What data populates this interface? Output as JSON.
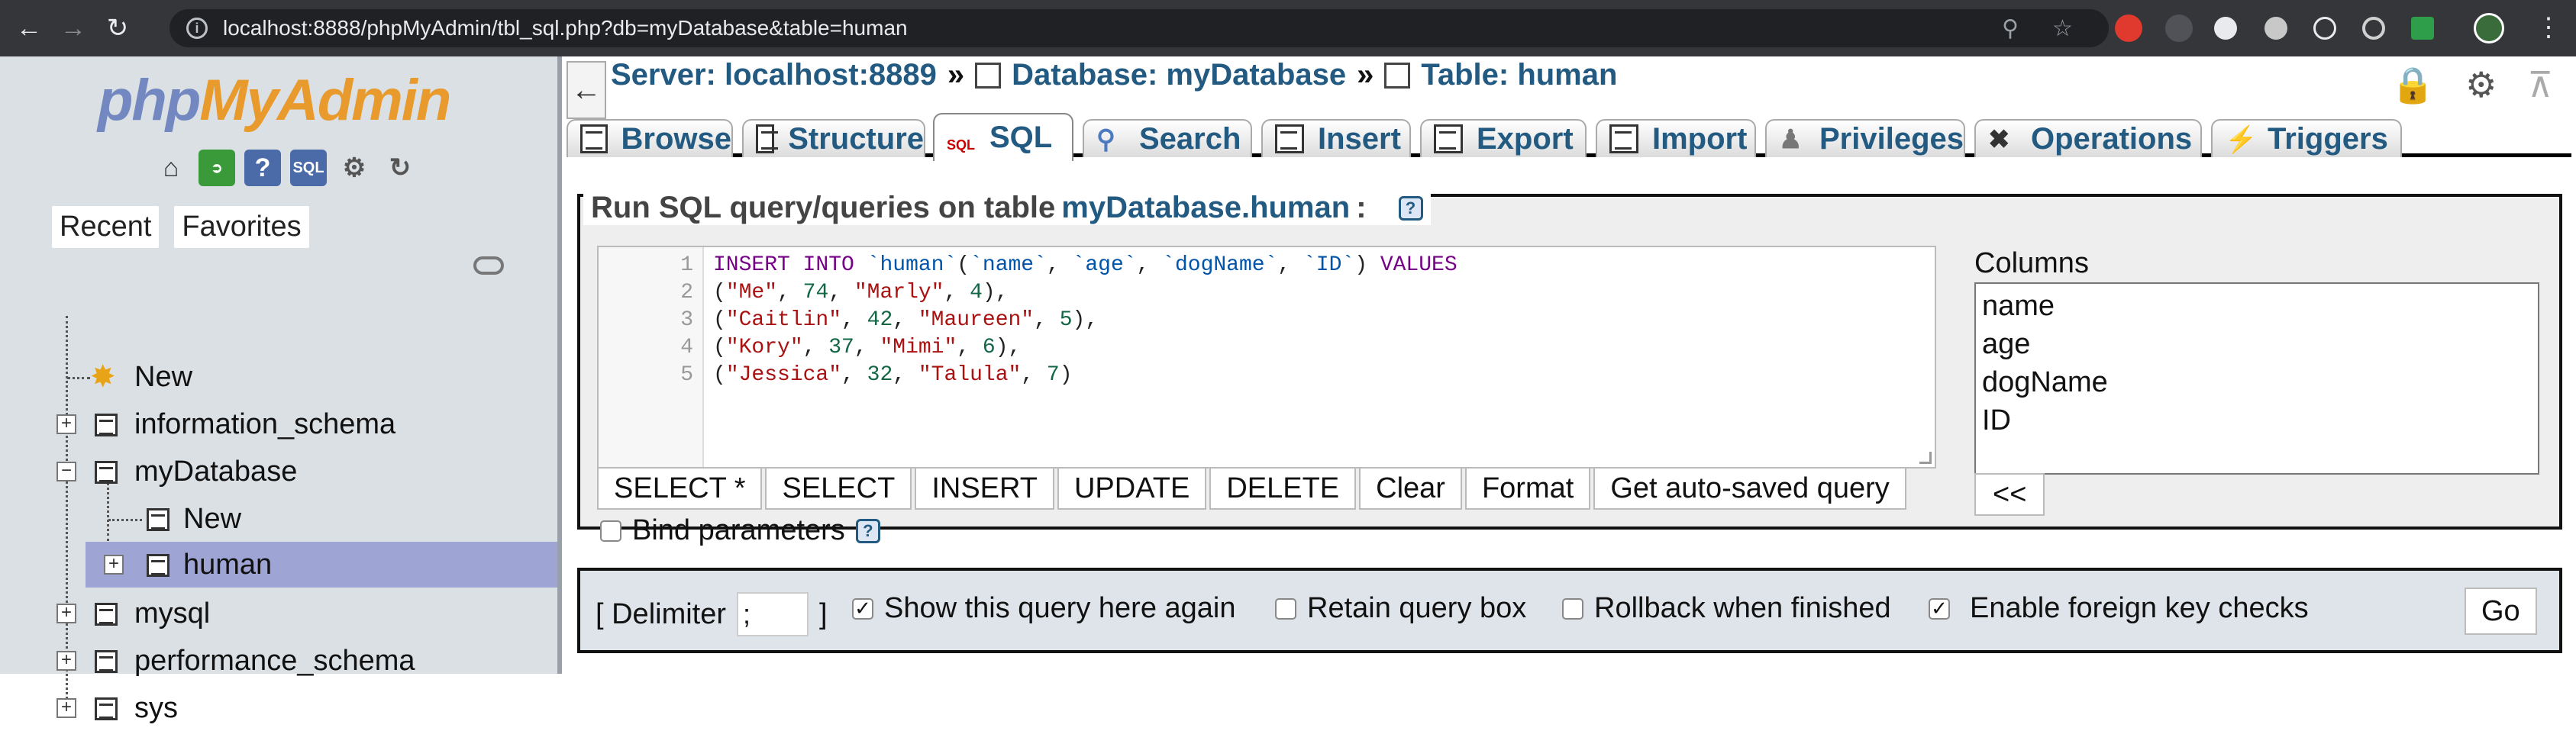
{
  "browser": {
    "url": "localhost:8888/phpMyAdmin/tbl_sql.php?db=myDatabase&table=human"
  },
  "sidebar": {
    "logo": {
      "php": "php",
      "my": "My",
      "admin": "Admin"
    },
    "recent_label": "Recent",
    "favorites_label": "Favorites",
    "tree": [
      {
        "label": "New"
      },
      {
        "label": "information_schema"
      },
      {
        "label": "myDatabase"
      },
      {
        "label": "New"
      },
      {
        "label": "human"
      },
      {
        "label": "mysql"
      },
      {
        "label": "performance_schema"
      },
      {
        "label": "sys"
      }
    ]
  },
  "breadcrumb": {
    "server": "Server: localhost:8889",
    "database": "Database: myDatabase",
    "table": "Table: human",
    "sep": "»"
  },
  "tabs": [
    {
      "label": "Browse"
    },
    {
      "label": "Structure"
    },
    {
      "label": "SQL"
    },
    {
      "label": "Search"
    },
    {
      "label": "Insert"
    },
    {
      "label": "Export"
    },
    {
      "label": "Import"
    },
    {
      "label": "Privileges"
    },
    {
      "label": "Operations"
    },
    {
      "label": "Triggers"
    }
  ],
  "query_box": {
    "legend_prefix": "Run SQL query/queries on table",
    "table_name": "myDatabase.human",
    "legend_suffix": ":",
    "line_numbers": [
      "1",
      "2",
      "3",
      "4",
      "5"
    ],
    "buttons": [
      "SELECT *",
      "SELECT",
      "INSERT",
      "UPDATE",
      "DELETE",
      "Clear",
      "Format",
      "Get auto-saved query"
    ],
    "bind_parameters": "Bind parameters",
    "columns_label": "Columns",
    "columns": [
      "name",
      "age",
      "dogName",
      "ID"
    ],
    "insert_column_button": "<<"
  },
  "sql": {
    "line1": {
      "kw1": "INSERT INTO",
      "t": "`human`",
      "c1": "`name`",
      "c2": "`age`",
      "c3": "`dogName`",
      "c4": "`ID`",
      "kw2": "VALUES"
    },
    "rows": [
      {
        "name": "\"Me\"",
        "age": "74",
        "dog": "\"Marly\"",
        "id": "4",
        "end": "),"
      },
      {
        "name": "\"Caitlin\"",
        "age": "42",
        "dog": "\"Maureen\"",
        "id": "5",
        "end": "),"
      },
      {
        "name": "\"Kory\"",
        "age": "37",
        "dog": "\"Mimi\"",
        "id": "6",
        "end": "),"
      },
      {
        "name": "\"Jessica\"",
        "age": "32",
        "dog": "\"Talula\"",
        "id": "7",
        "end": ")"
      }
    ]
  },
  "options": {
    "delimiter_label": "[ Delimiter",
    "delimiter_close": "]",
    "delimiter_value": ";",
    "show_query_again": {
      "label": "Show this query here again",
      "checked": true
    },
    "retain_query_box": {
      "label": "Retain query box",
      "checked": false
    },
    "rollback_when_finished": {
      "label": "Rollback when finished",
      "checked": false
    },
    "foreign_key_checks": {
      "label": "Enable foreign key checks",
      "checked": true
    },
    "go_button": "Go"
  }
}
